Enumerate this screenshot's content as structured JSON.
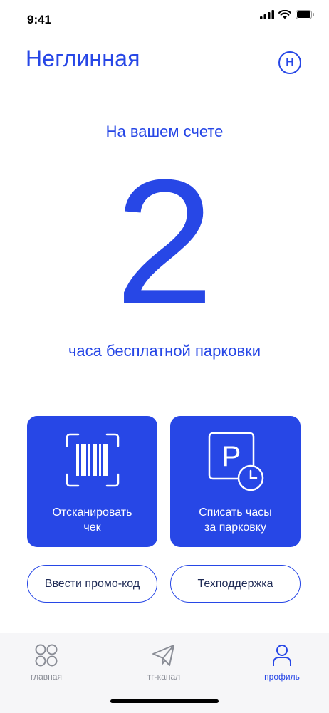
{
  "status_bar": {
    "time": "9:41"
  },
  "header": {
    "title": "Неглинная",
    "avatar_letter": "Н"
  },
  "balance": {
    "label": "На вашем счете",
    "value": "2",
    "caption": "часа бесплатной парковки"
  },
  "actions": {
    "scan_label": "Отсканировать\nчек",
    "spend_label": "Списать часы\nза парковку"
  },
  "buttons": {
    "promo_label": "Ввести промо-код",
    "support_label": "Техподдержка"
  },
  "tabbar": {
    "items": [
      {
        "label": "главная",
        "icon": "grid-icon",
        "active": false
      },
      {
        "label": "тг-канал",
        "icon": "paper-plane-icon",
        "active": false
      },
      {
        "label": "профиль",
        "icon": "user-icon",
        "active": true
      }
    ]
  },
  "colors": {
    "accent": "#2747e6",
    "tab_inactive": "#8a8d96",
    "button_text": "#1e2a55"
  }
}
